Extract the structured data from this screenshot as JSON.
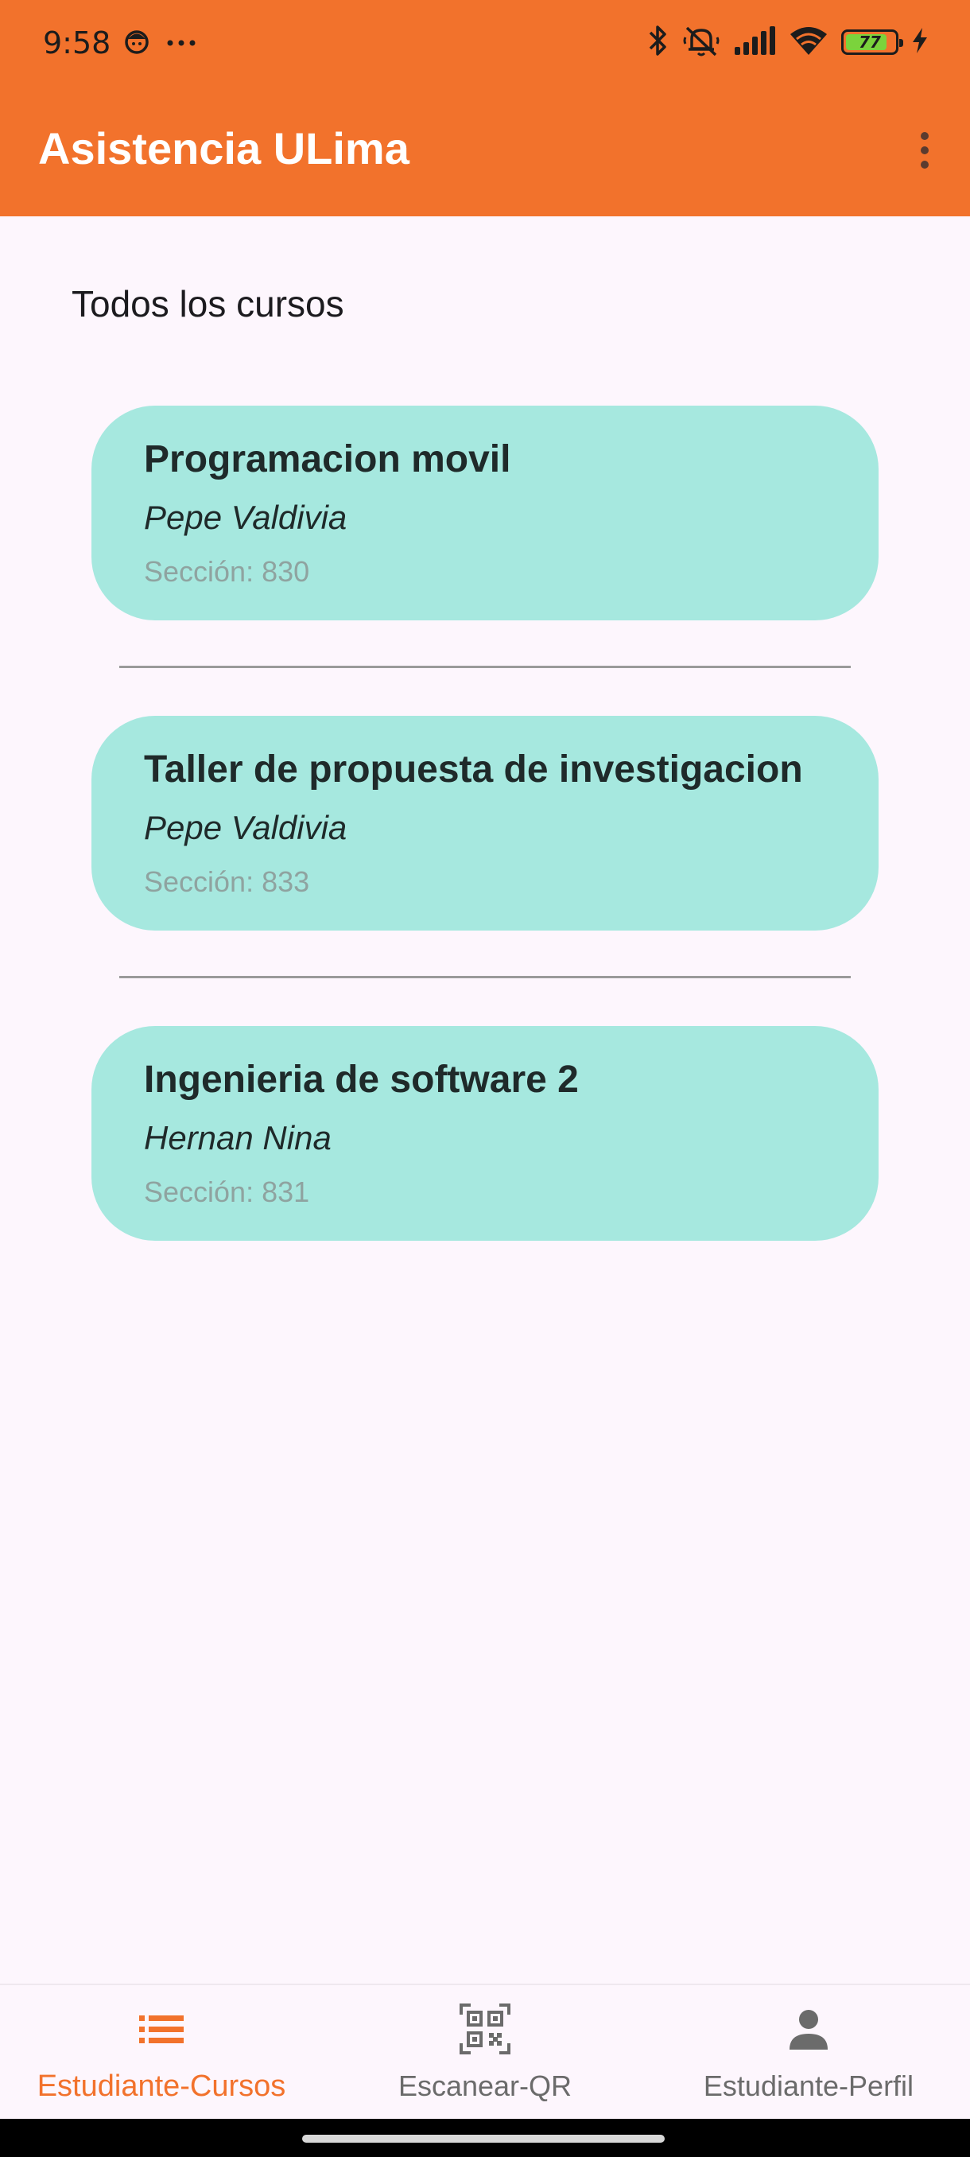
{
  "status_bar": {
    "time": "9:58",
    "battery_level": "77",
    "icons": [
      "face-icon",
      "more-dots-icon",
      "bluetooth-icon",
      "mute-icon",
      "signal-icon",
      "wifi-icon",
      "battery-icon",
      "charging-icon"
    ]
  },
  "app_bar": {
    "title": "Asistencia ULima"
  },
  "main": {
    "section_title": "Todos los cursos",
    "courses": [
      {
        "name": "Programacion movil",
        "professor": "Pepe Valdivia",
        "section": "Sección: 830"
      },
      {
        "name": "Taller de propuesta de investigacion",
        "professor": "Pepe Valdivia",
        "section": "Sección: 833"
      },
      {
        "name": "Ingenieria de software 2",
        "professor": "Hernan Nina",
        "section": "Sección: 831"
      }
    ]
  },
  "bottom_nav": {
    "items": [
      {
        "label": "Estudiante-Cursos",
        "icon": "list-icon",
        "active": true
      },
      {
        "label": "Escanear-QR",
        "icon": "qr-code-icon",
        "active": false
      },
      {
        "label": "Estudiante-Perfil",
        "icon": "person-icon",
        "active": false
      }
    ]
  },
  "colors": {
    "primary": "#F2722C",
    "card": "#A6E8DF",
    "background": "#FDF6FD"
  }
}
